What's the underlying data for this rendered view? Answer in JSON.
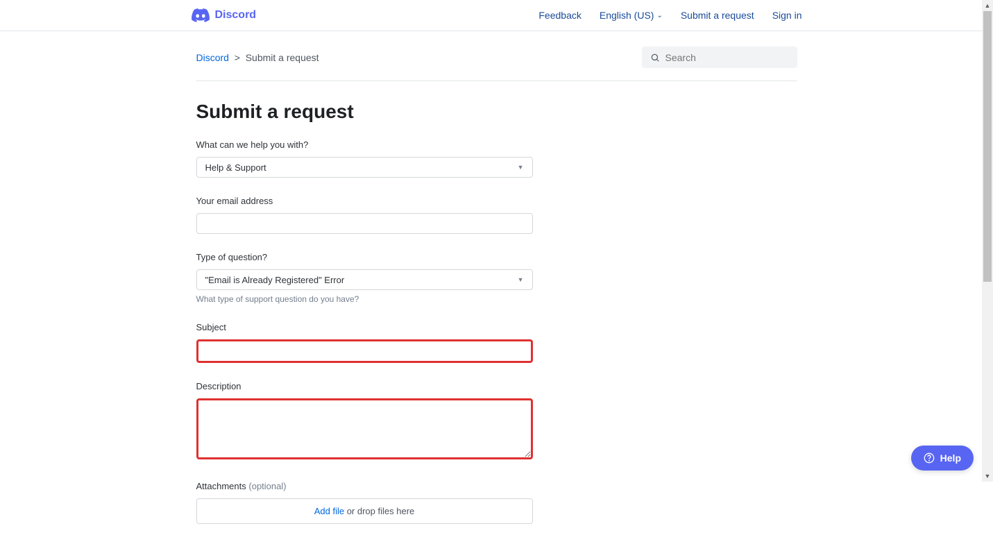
{
  "header": {
    "logo_text": "Discord",
    "nav": {
      "feedback": "Feedback",
      "language": "English (US)",
      "submit_request": "Submit a request",
      "sign_in": "Sign in"
    }
  },
  "breadcrumb": {
    "home": "Discord",
    "separator": ">",
    "current": "Submit a request"
  },
  "search": {
    "placeholder": "Search"
  },
  "page": {
    "title": "Submit a request"
  },
  "form": {
    "help_with": {
      "label": "What can we help you with?",
      "value": "Help & Support"
    },
    "email": {
      "label": "Your email address",
      "value": ""
    },
    "question_type": {
      "label": "Type of question?",
      "value": "\"Email is Already Registered\" Error",
      "help": "What type of support question do you have?"
    },
    "subject": {
      "label": "Subject",
      "value": ""
    },
    "description": {
      "label": "Description",
      "value": ""
    },
    "attachments": {
      "label": "Attachments",
      "optional": "(optional)",
      "add_file": "Add file",
      "drop_text": " or drop files here"
    }
  },
  "help_widget": {
    "label": "Help"
  }
}
